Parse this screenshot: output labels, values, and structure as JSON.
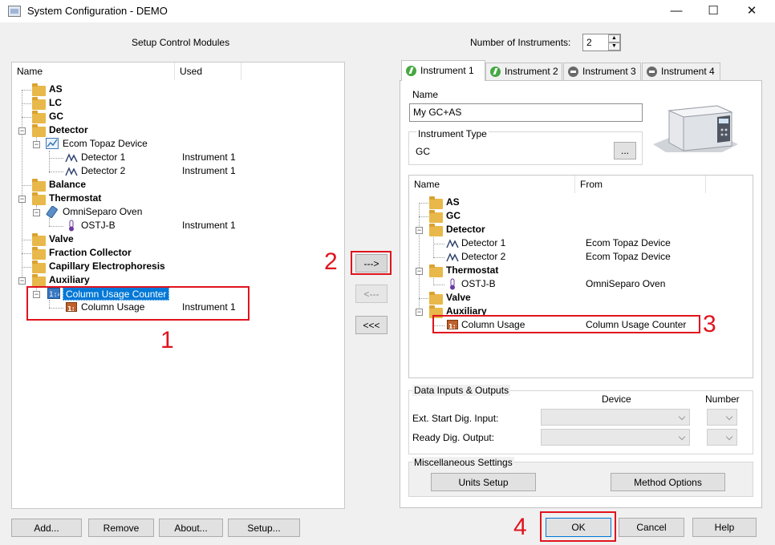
{
  "window": {
    "title": "System Configuration - DEMO",
    "minimize": "—",
    "maximize": "☐",
    "close": "✕"
  },
  "left": {
    "section_title": "Setup Control Modules",
    "columns": {
      "name": "Name",
      "used": "Used"
    },
    "tree": {
      "as": "AS",
      "lc": "LC",
      "gc": "GC",
      "detector": "Detector",
      "ecom": "Ecom Topaz Device",
      "detector1": "Detector 1",
      "detector1_used": "Instrument 1",
      "detector2": "Detector 2",
      "detector2_used": "Instrument 1",
      "balance": "Balance",
      "thermostat": "Thermostat",
      "oven": "OmniSeparo Oven",
      "ostj": "OSTJ-B",
      "ostj_used": "Instrument 1",
      "valve": "Valve",
      "fraction": "Fraction Collector",
      "capillary": "Capillary Electrophoresis",
      "auxiliary": "Auxiliary",
      "counter": "Column Usage Counter",
      "column_usage": "Column Usage",
      "column_usage_used": "Instrument 1"
    },
    "buttons": {
      "add": "Add...",
      "remove": "Remove",
      "about": "About...",
      "setup": "Setup..."
    }
  },
  "transfer": {
    "add": "--->",
    "remove": "<---",
    "remove_all": "<<<"
  },
  "right": {
    "num_instruments_label": "Number of Instruments:",
    "num_instruments_value": "2",
    "tabs": [
      "Instrument 1",
      "Instrument 2",
      "Instrument 3",
      "Instrument 4"
    ],
    "name_label": "Name",
    "name_value": "My GC+AS",
    "instrument_type_label": "Instrument Type",
    "instrument_type_value": "GC",
    "browse_label": "...",
    "columns": {
      "name": "Name",
      "from": "From"
    },
    "tree": {
      "as": "AS",
      "gc": "GC",
      "detector": "Detector",
      "detector1": "Detector 1",
      "detector1_from": "Ecom Topaz Device",
      "detector2": "Detector 2",
      "detector2_from": "Ecom Topaz Device",
      "thermostat": "Thermostat",
      "ostj": "OSTJ-B",
      "ostj_from": "OmniSeparo Oven",
      "valve": "Valve",
      "auxiliary": "Auxiliary",
      "column_usage": "Column Usage",
      "column_usage_from": "Column Usage Counter"
    },
    "io": {
      "group_label": "Data Inputs & Outputs",
      "device_label": "Device",
      "number_label": "Number",
      "ext_start": "Ext. Start Dig. Input:",
      "ready": "Ready Dig. Output:"
    },
    "misc": {
      "group_label": "Miscellaneous Settings",
      "units_setup": "Units Setup",
      "method_options": "Method Options"
    }
  },
  "footer": {
    "ok": "OK",
    "cancel": "Cancel",
    "help": "Help"
  },
  "annotations": [
    "1",
    "2",
    "3",
    "4"
  ],
  "colors": {
    "annotation_red": "#e0141e",
    "selection_blue": "#0078d7",
    "folder": "#e8b84a"
  }
}
